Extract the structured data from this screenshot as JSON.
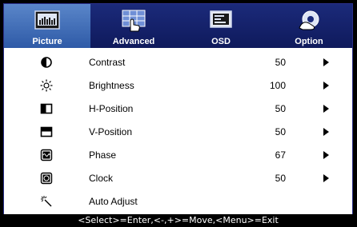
{
  "tabs": [
    {
      "label": "Picture",
      "icon": "picture-icon",
      "active": true
    },
    {
      "label": "Advanced",
      "icon": "advanced-icon",
      "active": false
    },
    {
      "label": "OSD",
      "icon": "osd-icon",
      "active": false
    },
    {
      "label": "Option",
      "icon": "option-icon",
      "active": false
    }
  ],
  "items": [
    {
      "label": "Contrast",
      "value": "50",
      "icon": "contrast-icon",
      "has_arrow": true
    },
    {
      "label": "Brightness",
      "value": "100",
      "icon": "brightness-icon",
      "has_arrow": true
    },
    {
      "label": "H-Position",
      "value": "50",
      "icon": "h-position-icon",
      "has_arrow": true
    },
    {
      "label": "V-Position",
      "value": "50",
      "icon": "v-position-icon",
      "has_arrow": true
    },
    {
      "label": "Phase",
      "value": "67",
      "icon": "phase-icon",
      "has_arrow": true
    },
    {
      "label": "Clock",
      "value": "50",
      "icon": "clock-icon",
      "has_arrow": true
    },
    {
      "label": "Auto Adjust",
      "value": "",
      "icon": "auto-adjust-icon",
      "has_arrow": false
    }
  ],
  "statusbar": {
    "text": "<Select>=Enter,<-,+>=Move,<Menu>=Exit"
  },
  "colors": {
    "tabbar": "#1b2a7a",
    "active_tab": "#5a86c9",
    "background": "#ffffff",
    "statusbar": "#000000"
  }
}
